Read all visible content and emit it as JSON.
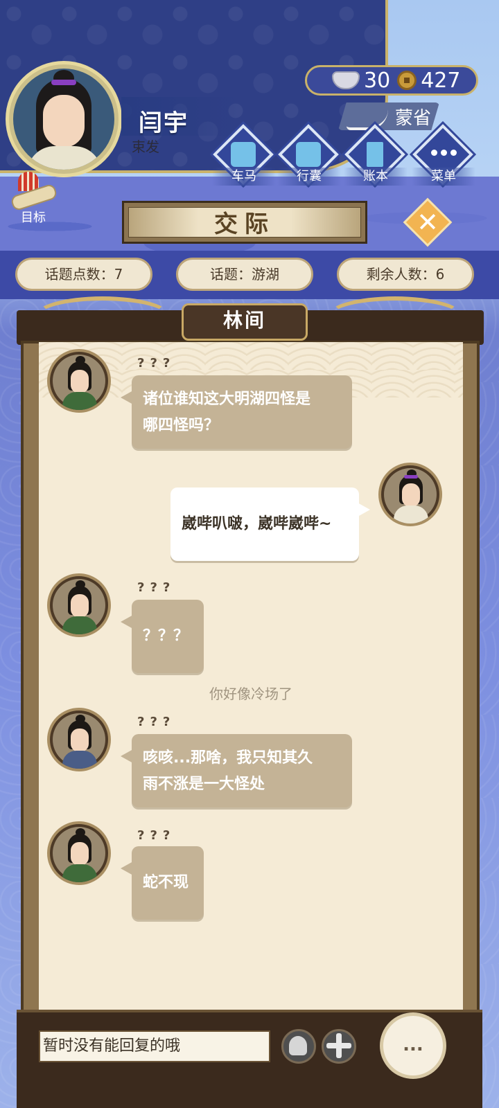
{
  "player": {
    "name": "闫宇",
    "title": "束发"
  },
  "currency": {
    "silver": "30",
    "coins": "427"
  },
  "location": "蒙省",
  "menu": [
    {
      "label": "车马",
      "icon": "carriage-icon"
    },
    {
      "label": "行囊",
      "icon": "bag-icon"
    },
    {
      "label": "账本",
      "icon": "ledger-icon"
    },
    {
      "label": "菜单",
      "icon": "more-icon"
    }
  ],
  "goal_label": "目标",
  "screen_title": "交际",
  "stats": {
    "topic_points": "话题点数：7",
    "topic": "话题：游湖",
    "remaining": "剩余人数：6"
  },
  "place": "林间",
  "chat": {
    "messages": [
      {
        "speaker": "???",
        "text_line1": "诸位谁知这大明湖四怪是",
        "text_line2": "哪四怪吗？",
        "self": false
      },
      {
        "speaker": "",
        "text_line1": "崴哔叭啵，崴哔崴哔~",
        "text_line2": "",
        "self": true
      },
      {
        "speaker": "???",
        "text_line1": "？？？",
        "text_line2": "",
        "self": false
      },
      {
        "speaker": "???",
        "text_line1": "咳咳...那啥，我只知其久",
        "text_line2": "雨不涨是一大怪处",
        "self": false
      },
      {
        "speaker": "???",
        "text_line1": "蛇不现",
        "text_line2": "",
        "self": false
      }
    ],
    "system_note": "你好像冷场了"
  },
  "input": {
    "text": "暂时没有能回复的哦"
  },
  "more_button": "..."
}
